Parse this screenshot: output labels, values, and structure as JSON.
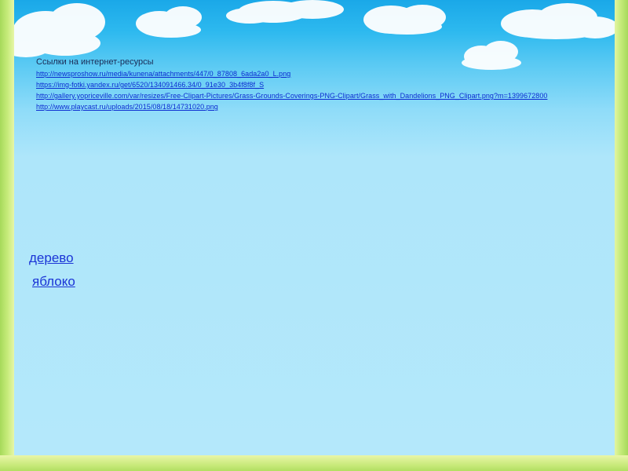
{
  "links_section": {
    "title": "Ссылки на интернет-ресурсы",
    "links": [
      "http://newsproshow.ru/media/kunena/attachments/447/0_87808_6ada2a0_L.png",
      "https://img-fotki.yandex.ru/get/6520/134091466.34/0_91e30_3b4f8f8f_S",
      "http://gallery.yopriceville.com/var/resizes/Free-Clipart-Pictures/Grass-Grounds-Coverings-PNG-Clipart/Grass_with_Dandelions_PNG_Clipart.png?m=1399672800",
      "http://www.playcast.ru/uploads/2015/08/18/14731020.png"
    ]
  },
  "words": {
    "derevo": "дерево",
    "yabloko": "яблоко"
  },
  "colors": {
    "sky_top": "#1aa8e8",
    "sky_bottom": "#b4e8fb",
    "frame_green": "#a6d95a",
    "frame_yellow": "#f7f3b2",
    "link": "#0b2bd0",
    "word_link": "#1b35d6"
  },
  "icons": [
    "cloud-icon"
  ]
}
